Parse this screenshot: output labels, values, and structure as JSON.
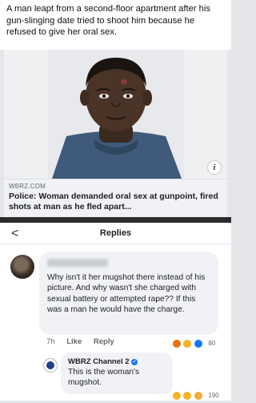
{
  "post": {
    "caption": "A man leapt from a second-floor apartment after his gun-slinging date tried to shoot him because he refused to give her oral sex.",
    "source": "WBRZ.COM",
    "headline": "Police: Woman demanded oral sex at gunpoint, fired shots at man as he fled apart...",
    "info_icon_glyph": "i"
  },
  "replies": {
    "back_glyph": "<",
    "title": "Replies",
    "comment": {
      "text": "Why isn't it her mugshot there instead of his picture. And why wasn't she charged with sexual battery or attempted rape?? If this was a man he would have the charge.",
      "time": "7h",
      "like_label": "Like",
      "reply_label": "Reply",
      "reaction_count": "80",
      "reaction_icons": [
        "angry-icon",
        "haha-icon",
        "wow-icon"
      ]
    },
    "reply": {
      "author": "WBRZ Channel 2",
      "verified_glyph": "✓",
      "text": "This is the woman's mugshot.",
      "reaction_count": "190",
      "reaction_icons": [
        "haha-icon",
        "wow-icon",
        "care-icon"
      ]
    }
  },
  "colors": {
    "link_bg": "#f0f2f5",
    "accent": "#1877f2",
    "separator": "#2b2b2b"
  }
}
